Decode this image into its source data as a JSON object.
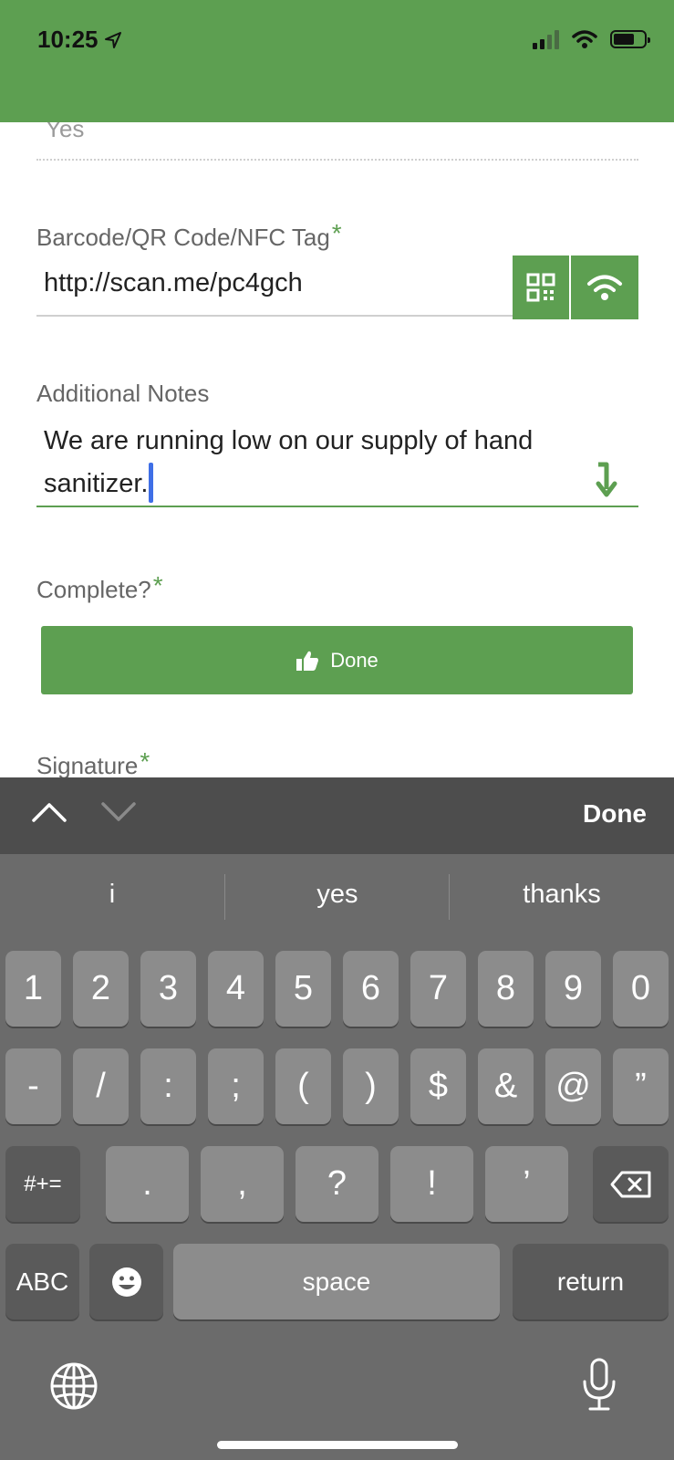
{
  "status": {
    "time": "10:25"
  },
  "form": {
    "prev_value": "Yes",
    "barcode": {
      "label": "Barcode/QR Code/NFC Tag",
      "required": "*",
      "value": "http://scan.me/pc4gch"
    },
    "notes": {
      "label": "Additional Notes",
      "value": "We are running low on our supply of hand sanitizer."
    },
    "complete": {
      "label": "Complete?",
      "required": "*",
      "button_label": "Done"
    },
    "signature": {
      "label": "Signature",
      "required": "*"
    }
  },
  "accessory": {
    "done_label": "Done"
  },
  "keyboard": {
    "suggestions": [
      "i",
      "yes",
      "thanks"
    ],
    "row1": [
      "1",
      "2",
      "3",
      "4",
      "5",
      "6",
      "7",
      "8",
      "9",
      "0"
    ],
    "row2": [
      "-",
      "/",
      ":",
      ";",
      "(",
      ")",
      "$",
      "&",
      "@",
      "”"
    ],
    "row3": {
      "shift": "#+=",
      "keys": [
        ".",
        ",",
        "?",
        "!",
        "’"
      ]
    },
    "row4": {
      "abc": "ABC",
      "space": "space",
      "return": "return"
    }
  },
  "colors": {
    "brand": "#5d9f51",
    "caret": "#3f6fe6"
  },
  "icons": [
    "location-arrow-icon",
    "signal-icon",
    "wifi-icon",
    "battery-icon",
    "qr-code-icon",
    "nfc-icon",
    "expand-down-icon",
    "thumbs-up-icon",
    "chevron-up-icon",
    "chevron-down-icon",
    "backspace-icon",
    "emoji-icon",
    "globe-icon",
    "microphone-icon"
  ]
}
